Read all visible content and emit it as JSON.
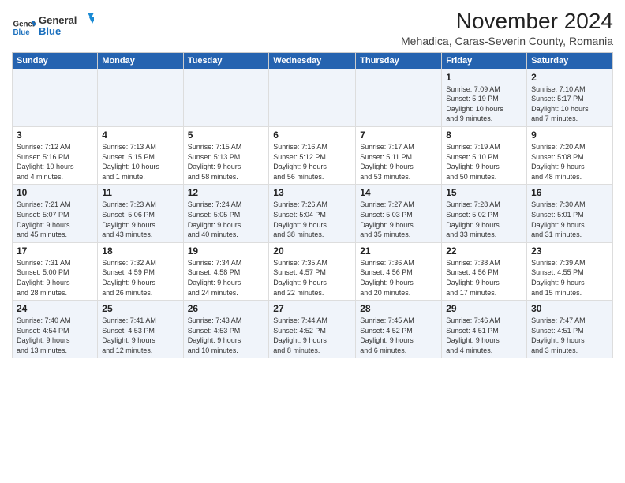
{
  "logo": {
    "line1": "General",
    "line2": "Blue"
  },
  "title": "November 2024",
  "subtitle": "Mehadica, Caras-Severin County, Romania",
  "headers": [
    "Sunday",
    "Monday",
    "Tuesday",
    "Wednesday",
    "Thursday",
    "Friday",
    "Saturday"
  ],
  "weeks": [
    [
      {
        "day": "",
        "info": ""
      },
      {
        "day": "",
        "info": ""
      },
      {
        "day": "",
        "info": ""
      },
      {
        "day": "",
        "info": ""
      },
      {
        "day": "",
        "info": ""
      },
      {
        "day": "1",
        "info": "Sunrise: 7:09 AM\nSunset: 5:19 PM\nDaylight: 10 hours\nand 9 minutes."
      },
      {
        "day": "2",
        "info": "Sunrise: 7:10 AM\nSunset: 5:17 PM\nDaylight: 10 hours\nand 7 minutes."
      }
    ],
    [
      {
        "day": "3",
        "info": "Sunrise: 7:12 AM\nSunset: 5:16 PM\nDaylight: 10 hours\nand 4 minutes."
      },
      {
        "day": "4",
        "info": "Sunrise: 7:13 AM\nSunset: 5:15 PM\nDaylight: 10 hours\nand 1 minute."
      },
      {
        "day": "5",
        "info": "Sunrise: 7:15 AM\nSunset: 5:13 PM\nDaylight: 9 hours\nand 58 minutes."
      },
      {
        "day": "6",
        "info": "Sunrise: 7:16 AM\nSunset: 5:12 PM\nDaylight: 9 hours\nand 56 minutes."
      },
      {
        "day": "7",
        "info": "Sunrise: 7:17 AM\nSunset: 5:11 PM\nDaylight: 9 hours\nand 53 minutes."
      },
      {
        "day": "8",
        "info": "Sunrise: 7:19 AM\nSunset: 5:10 PM\nDaylight: 9 hours\nand 50 minutes."
      },
      {
        "day": "9",
        "info": "Sunrise: 7:20 AM\nSunset: 5:08 PM\nDaylight: 9 hours\nand 48 minutes."
      }
    ],
    [
      {
        "day": "10",
        "info": "Sunrise: 7:21 AM\nSunset: 5:07 PM\nDaylight: 9 hours\nand 45 minutes."
      },
      {
        "day": "11",
        "info": "Sunrise: 7:23 AM\nSunset: 5:06 PM\nDaylight: 9 hours\nand 43 minutes."
      },
      {
        "day": "12",
        "info": "Sunrise: 7:24 AM\nSunset: 5:05 PM\nDaylight: 9 hours\nand 40 minutes."
      },
      {
        "day": "13",
        "info": "Sunrise: 7:26 AM\nSunset: 5:04 PM\nDaylight: 9 hours\nand 38 minutes."
      },
      {
        "day": "14",
        "info": "Sunrise: 7:27 AM\nSunset: 5:03 PM\nDaylight: 9 hours\nand 35 minutes."
      },
      {
        "day": "15",
        "info": "Sunrise: 7:28 AM\nSunset: 5:02 PM\nDaylight: 9 hours\nand 33 minutes."
      },
      {
        "day": "16",
        "info": "Sunrise: 7:30 AM\nSunset: 5:01 PM\nDaylight: 9 hours\nand 31 minutes."
      }
    ],
    [
      {
        "day": "17",
        "info": "Sunrise: 7:31 AM\nSunset: 5:00 PM\nDaylight: 9 hours\nand 28 minutes."
      },
      {
        "day": "18",
        "info": "Sunrise: 7:32 AM\nSunset: 4:59 PM\nDaylight: 9 hours\nand 26 minutes."
      },
      {
        "day": "19",
        "info": "Sunrise: 7:34 AM\nSunset: 4:58 PM\nDaylight: 9 hours\nand 24 minutes."
      },
      {
        "day": "20",
        "info": "Sunrise: 7:35 AM\nSunset: 4:57 PM\nDaylight: 9 hours\nand 22 minutes."
      },
      {
        "day": "21",
        "info": "Sunrise: 7:36 AM\nSunset: 4:56 PM\nDaylight: 9 hours\nand 20 minutes."
      },
      {
        "day": "22",
        "info": "Sunrise: 7:38 AM\nSunset: 4:56 PM\nDaylight: 9 hours\nand 17 minutes."
      },
      {
        "day": "23",
        "info": "Sunrise: 7:39 AM\nSunset: 4:55 PM\nDaylight: 9 hours\nand 15 minutes."
      }
    ],
    [
      {
        "day": "24",
        "info": "Sunrise: 7:40 AM\nSunset: 4:54 PM\nDaylight: 9 hours\nand 13 minutes."
      },
      {
        "day": "25",
        "info": "Sunrise: 7:41 AM\nSunset: 4:53 PM\nDaylight: 9 hours\nand 12 minutes."
      },
      {
        "day": "26",
        "info": "Sunrise: 7:43 AM\nSunset: 4:53 PM\nDaylight: 9 hours\nand 10 minutes."
      },
      {
        "day": "27",
        "info": "Sunrise: 7:44 AM\nSunset: 4:52 PM\nDaylight: 9 hours\nand 8 minutes."
      },
      {
        "day": "28",
        "info": "Sunrise: 7:45 AM\nSunset: 4:52 PM\nDaylight: 9 hours\nand 6 minutes."
      },
      {
        "day": "29",
        "info": "Sunrise: 7:46 AM\nSunset: 4:51 PM\nDaylight: 9 hours\nand 4 minutes."
      },
      {
        "day": "30",
        "info": "Sunrise: 7:47 AM\nSunset: 4:51 PM\nDaylight: 9 hours\nand 3 minutes."
      }
    ]
  ]
}
